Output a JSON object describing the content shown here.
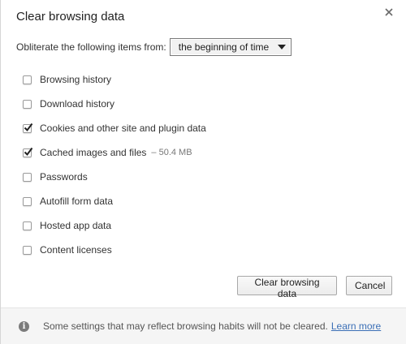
{
  "dialog": {
    "title": "Clear browsing data",
    "close_icon": "close-icon"
  },
  "range": {
    "label": "Obliterate the following items from:",
    "selected": "the beginning of time"
  },
  "items": [
    {
      "label": "Browsing history",
      "checked": false,
      "extra": ""
    },
    {
      "label": "Download history",
      "checked": false,
      "extra": ""
    },
    {
      "label": "Cookies and other site and plugin data",
      "checked": true,
      "extra": ""
    },
    {
      "label": "Cached images and files",
      "checked": true,
      "extra": "– 50.4 MB"
    },
    {
      "label": "Passwords",
      "checked": false,
      "extra": ""
    },
    {
      "label": "Autofill form data",
      "checked": false,
      "extra": ""
    },
    {
      "label": "Hosted app data",
      "checked": false,
      "extra": ""
    },
    {
      "label": "Content licenses",
      "checked": false,
      "extra": ""
    }
  ],
  "buttons": {
    "clear_label": "Clear browsing data",
    "cancel_label": "Cancel"
  },
  "footer": {
    "info_icon": "info-icon",
    "text": "Some settings that may reflect browsing habits will not be cleared.",
    "link": "Learn more"
  }
}
